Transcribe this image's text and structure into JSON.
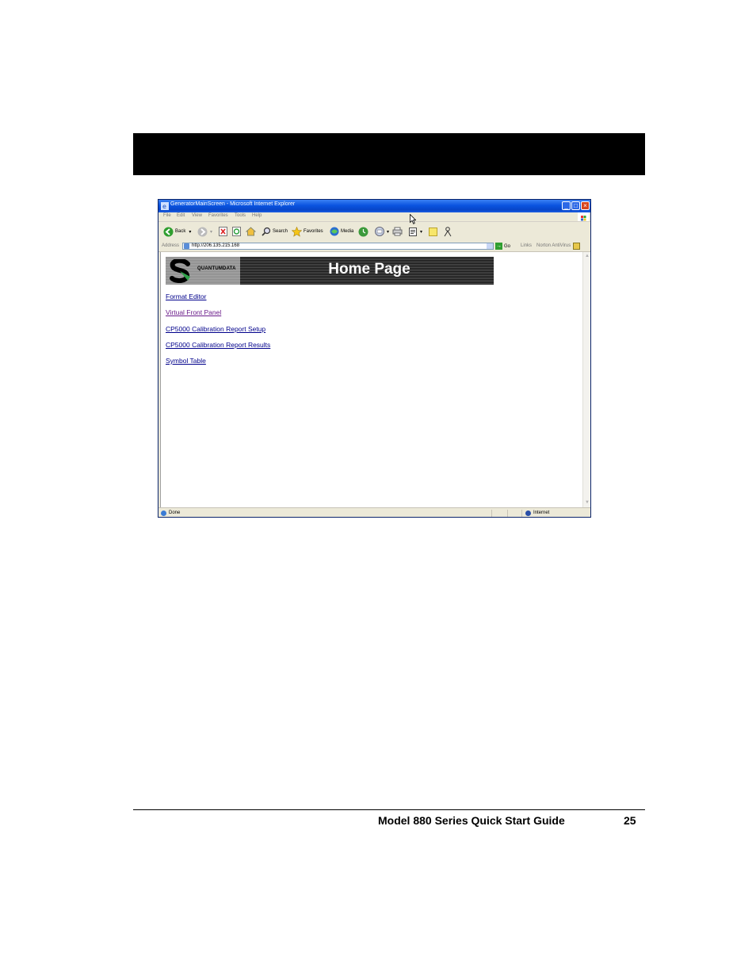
{
  "browser": {
    "title": "GeneratorMainScreen - Microsoft Internet Explorer",
    "menu": [
      "File",
      "Edit",
      "View",
      "Favorites",
      "Tools",
      "Help"
    ],
    "toolbar": {
      "back_label": "Back",
      "search_label": "Search",
      "favorites_label": "Favorites",
      "media_label": "Media"
    },
    "address": {
      "label": "Address",
      "url": "http://206.135.215.168",
      "go_label": "Go",
      "links_label": "Links",
      "norton_label": "Norton AntiVirus"
    },
    "status": {
      "text": "Done",
      "zone": "Internet"
    }
  },
  "page": {
    "logo_text": "QUANTUMDATA",
    "banner_title": "Home Page",
    "links": [
      {
        "label": "Format Editor",
        "visited": false
      },
      {
        "label": "Virtual Front Panel",
        "visited": true
      },
      {
        "label": "CP5000 Calibration Report Setup",
        "visited": false
      },
      {
        "label": "CP5000 Calibration Report Results",
        "visited": false
      },
      {
        "label": "Symbol Table",
        "visited": false
      }
    ]
  },
  "footer": {
    "guide_title": "Model 880 Series Quick Start Guide",
    "page_number": "25"
  },
  "colors": {
    "link": "#00008b",
    "visited_link": "#6a1b8a",
    "titlebar": "#0a54e0"
  }
}
